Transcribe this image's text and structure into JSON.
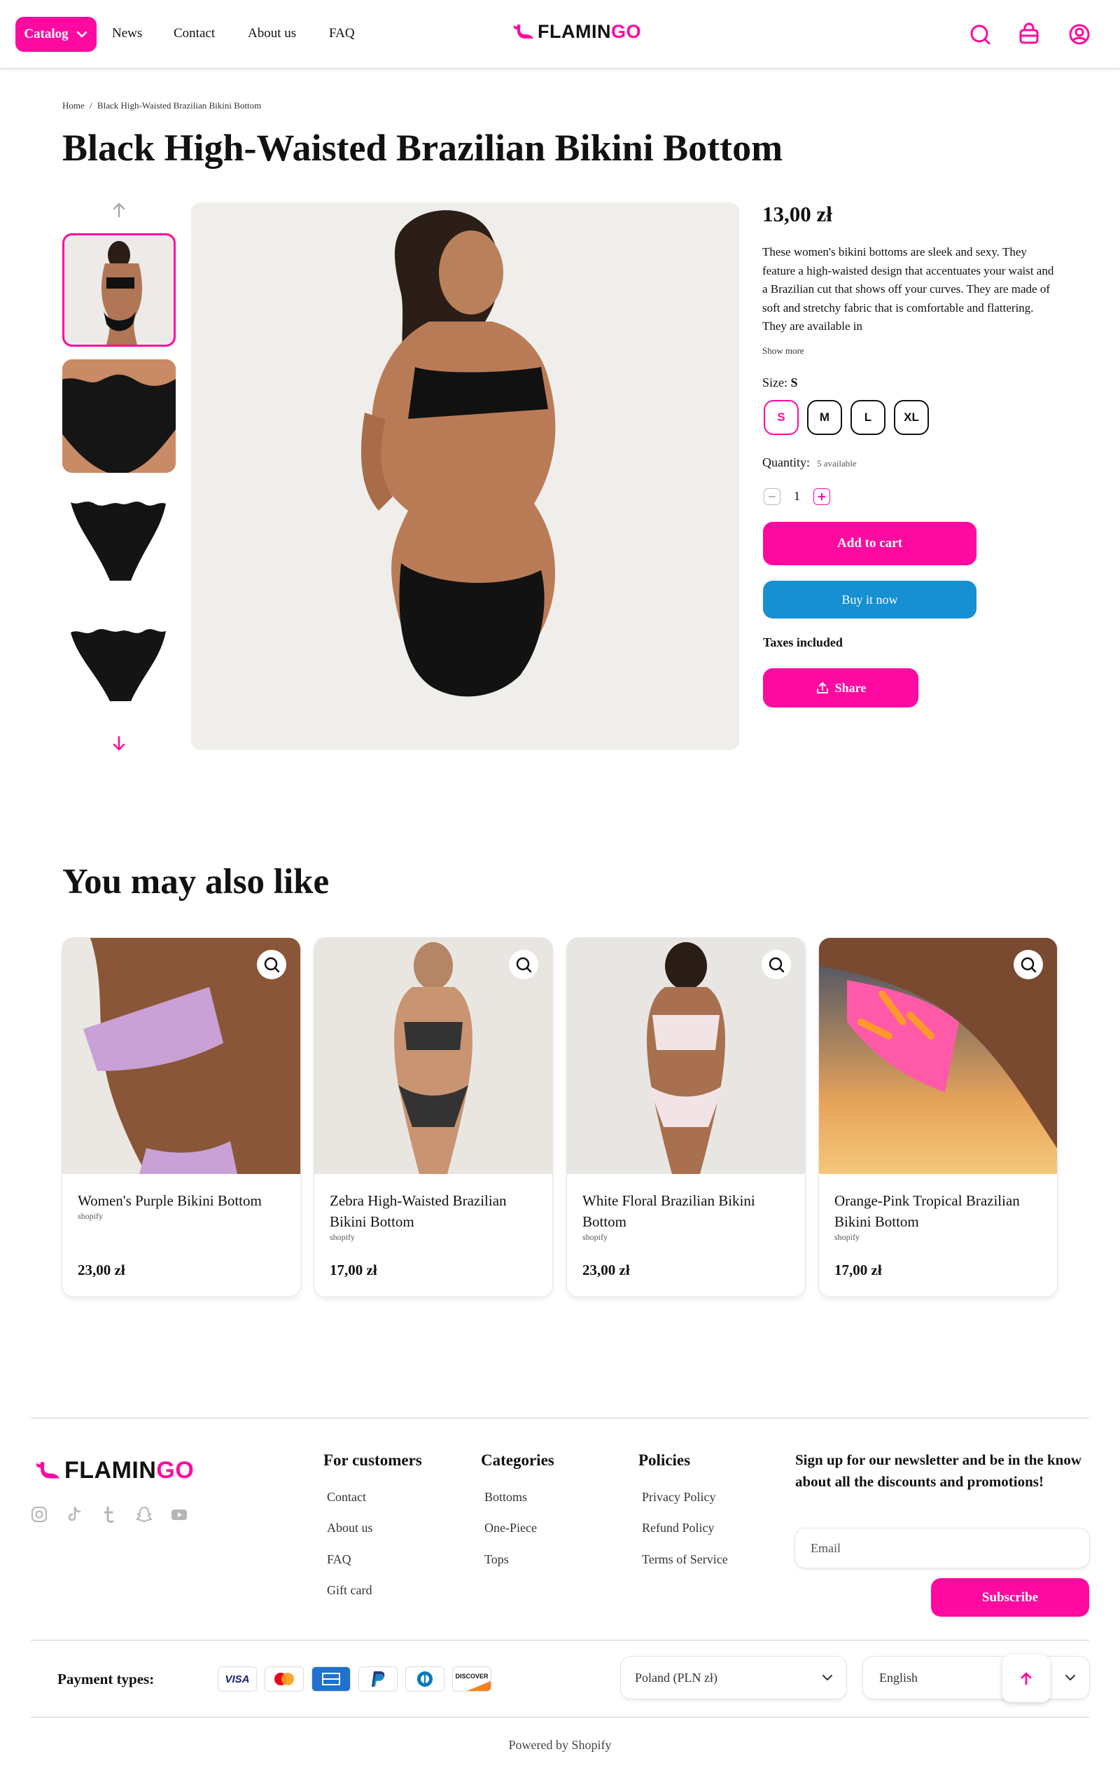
{
  "header": {
    "catalog_label": "Catalog",
    "nav": [
      "News",
      "Contact",
      "About us",
      "FAQ"
    ],
    "logo": {
      "part1": "FLAMIN",
      "part2": "GO"
    }
  },
  "breadcrumb": {
    "home": "Home",
    "separator": "/",
    "current": "Black High-Waisted Brazilian Bikini Bottom"
  },
  "product": {
    "title": "Black High-Waisted Brazilian Bikini Bottom",
    "price": "13,00 zł",
    "description": "These women's bikini bottoms are sleek and sexy. They feature a high-waisted design that accentuates your waist and a Brazilian cut that shows off your curves. They are made of soft and stretchy fabric that is comfortable and flattering. They are available in",
    "show_more": "Show more",
    "size_label": "Size:",
    "size_value": "S",
    "sizes": [
      "S",
      "M",
      "L",
      "XL"
    ],
    "selected_size": "S",
    "quantity_label": "Quantity:",
    "availability": "5 available",
    "quantity": "1",
    "add_to_cart": "Add to cart",
    "buy_now": "Buy it now",
    "taxes": "Taxes included",
    "share": "Share"
  },
  "recommendations": {
    "title": "You may also like",
    "items": [
      {
        "name": "Women's Purple Bikini Bottom",
        "vendor": "shopify",
        "price": "23,00 zł"
      },
      {
        "name": "Zebra High-Waisted Brazilian Bikini Bottom",
        "vendor": "shopify",
        "price": "17,00 zł"
      },
      {
        "name": "White Floral Brazilian Bikini Bottom",
        "vendor": "shopify",
        "price": "23,00 zł"
      },
      {
        "name": "Orange-Pink Tropical Brazilian Bikini Bottom",
        "vendor": "shopify",
        "price": "17,00 zł"
      }
    ]
  },
  "footer": {
    "for_customers": {
      "title": "For customers",
      "links": [
        "Contact",
        "About us",
        "FAQ",
        "Gift card"
      ]
    },
    "categories": {
      "title": "Categories",
      "links": [
        "Bottoms",
        "One-Piece",
        "Tops"
      ]
    },
    "policies": {
      "title": "Policies",
      "links": [
        "Privacy Policy",
        "Refund Policy",
        "Terms of Service"
      ]
    },
    "newsletter": {
      "text": "Sign up for our newsletter and be in the know about all the discounts and promotions!",
      "placeholder": "Email",
      "button": "Subscribe"
    },
    "payment_label": "Payment types:",
    "payment_methods": [
      "VISA",
      "Mastercard",
      "American Express",
      "PayPal",
      "Diners Club",
      "DISCOVER"
    ],
    "country": "Poland (PLN zł)",
    "language": "English",
    "powered_by": "Powered by Shopify",
    "social_icons": [
      "instagram-icon",
      "tiktok-icon",
      "tumblr-icon",
      "snapchat-icon",
      "youtube-icon"
    ]
  },
  "colors": {
    "accent": "#ff0aa0",
    "buy_now": "#1690d3",
    "text": "#111111"
  }
}
